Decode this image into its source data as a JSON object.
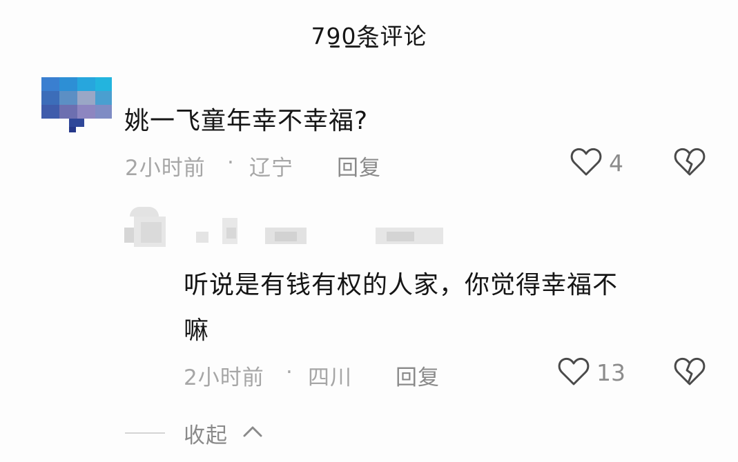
{
  "header": {
    "title": "790条评论"
  },
  "comments": [
    {
      "text": "姚一飞童年幸不幸福?",
      "time": "2小时前",
      "separator": "·",
      "location": "辽宁",
      "reply_label": "回复",
      "likes": "4",
      "replies": [
        {
          "text_line1": "听说是有钱有权的人家，你觉得幸福不",
          "text_line2": "嘛",
          "time": "2小时前",
          "separator": "·",
          "location": "四川",
          "reply_label": "回复",
          "likes": "13"
        }
      ]
    }
  ],
  "collapse_label": "收起",
  "icons": {
    "like": "heart-outline-icon",
    "dislike": "broken-heart-icon",
    "collapse": "chevron-up-icon"
  },
  "colors": {
    "text_primary": "#151515",
    "text_meta": "#a6a6a6",
    "text_action": "#8a8a8a"
  }
}
